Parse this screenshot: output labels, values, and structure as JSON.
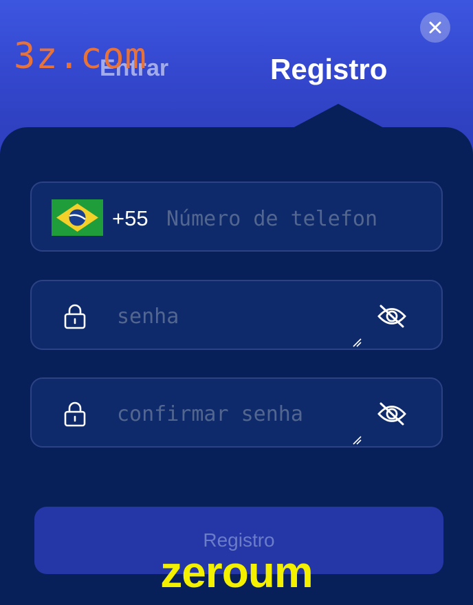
{
  "tabs": {
    "login_label": "Entrar",
    "register_label": "Registro"
  },
  "form": {
    "phone": {
      "country": "brazil-flag",
      "country_code": "+55",
      "placeholder": "Número de telefon"
    },
    "password": {
      "placeholder": "senha"
    },
    "confirm_password": {
      "placeholder": "confirmar senha"
    },
    "submit_label": "Registro"
  },
  "watermarks": {
    "top": "3z.com",
    "bottom": "zeroum"
  },
  "icons": {
    "close": "close-icon",
    "lock": "lock-icon",
    "hidden_eye": "eye-off-icon"
  },
  "colors": {
    "header_gradient_top": "#3d56e0",
    "panel_background": "#08205a",
    "field_background": "#0e2a6b",
    "button_background": "#2537a6",
    "watermark_top": "#e8733a",
    "watermark_bottom": "#f3f000"
  }
}
